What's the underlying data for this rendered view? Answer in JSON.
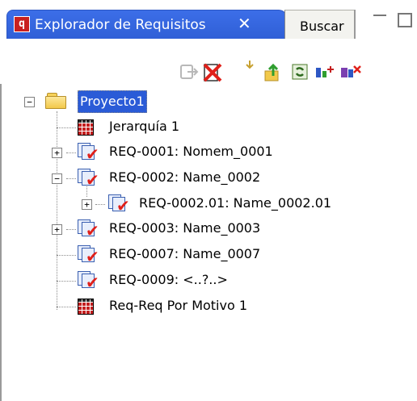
{
  "tabs": {
    "active": {
      "icon_text": "q",
      "label": "Explorador de Requisitos",
      "close": "✕"
    },
    "other": {
      "label": "Buscar"
    }
  },
  "toolbar": {
    "buttons": [
      "export-icon",
      "delete-red-x-icon",
      "move-down-icon",
      "go-up-folder-icon",
      "refresh-icon",
      "add-relation-icon",
      "remove-relation-icon"
    ]
  },
  "tree": {
    "root": {
      "label": "Proyecto1",
      "expander": "−"
    },
    "items": [
      {
        "label": "Jerarquía 1",
        "type": "matrix",
        "expander": ""
      },
      {
        "label": "REQ-0001: Nomem_0001",
        "type": "req",
        "expander": "+"
      },
      {
        "label": "REQ-0002: Name_0002",
        "type": "req",
        "expander": "−"
      },
      {
        "label": "REQ-0002.01: Name_0002.01",
        "type": "req",
        "expander": "+",
        "child": true
      },
      {
        "label": "REQ-0003: Name_0003",
        "type": "req",
        "expander": "+"
      },
      {
        "label": "REQ-0007: Name_0007",
        "type": "req",
        "expander": ""
      },
      {
        "label": "REQ-0009: <..?..>",
        "type": "req",
        "expander": ""
      },
      {
        "label": "Req-Req Por Motivo 1",
        "type": "matrix",
        "expander": ""
      }
    ]
  }
}
